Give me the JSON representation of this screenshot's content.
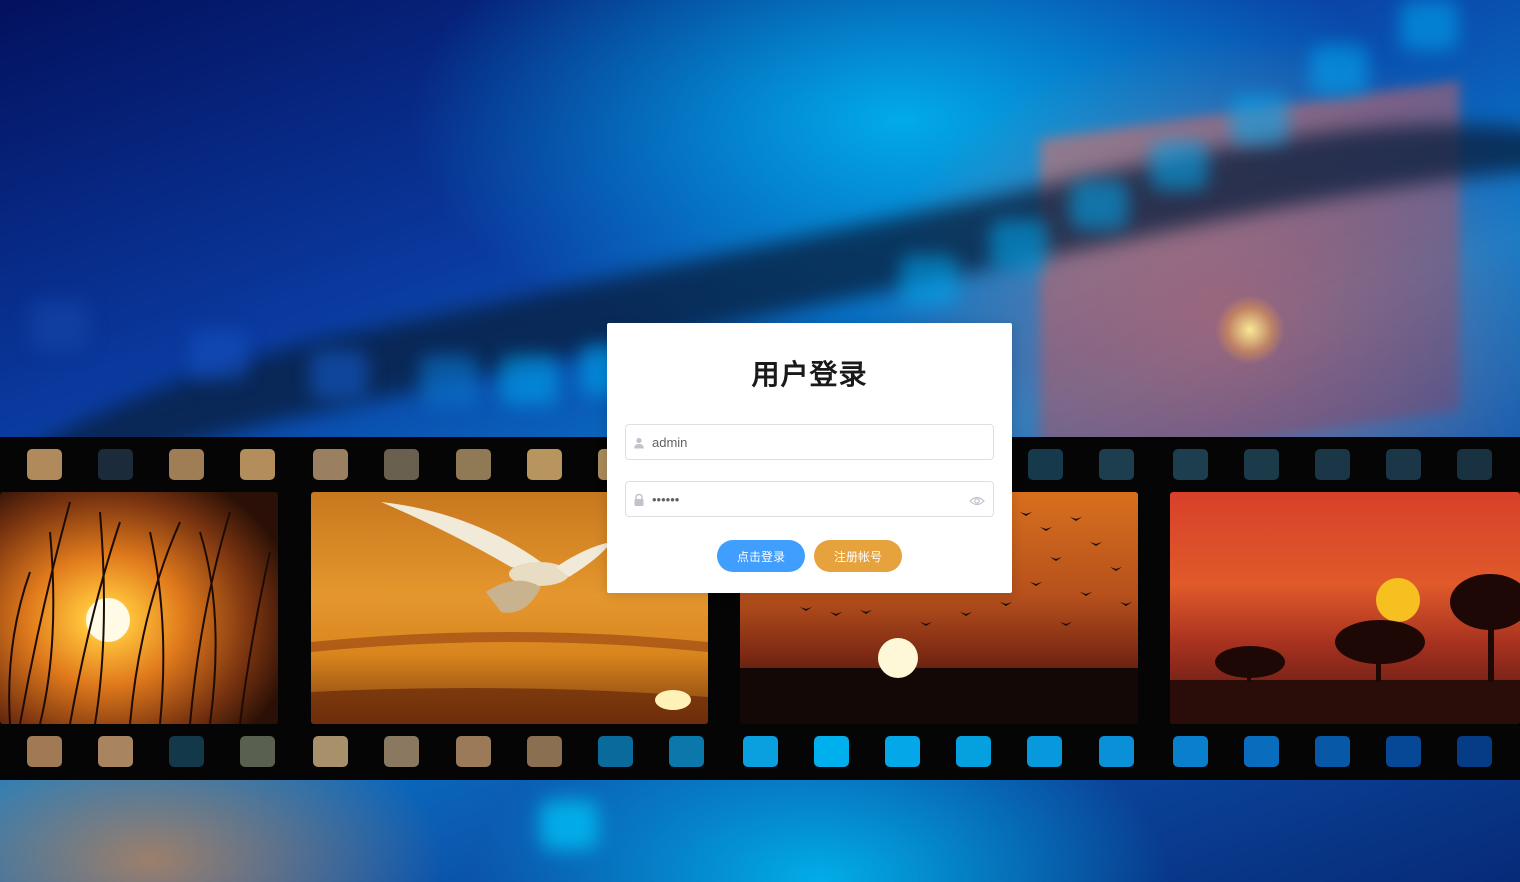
{
  "login": {
    "title": "用户登录",
    "username_value": "admin",
    "password_value": "••••••",
    "login_button": "点击登录",
    "register_button": "注册帐号"
  },
  "icons": {
    "user": "user-icon",
    "lock": "lock-icon",
    "eye": "eye-icon"
  },
  "colors": {
    "primary": "#409eff",
    "warning": "#e6a23c",
    "card": "#ffffff"
  }
}
